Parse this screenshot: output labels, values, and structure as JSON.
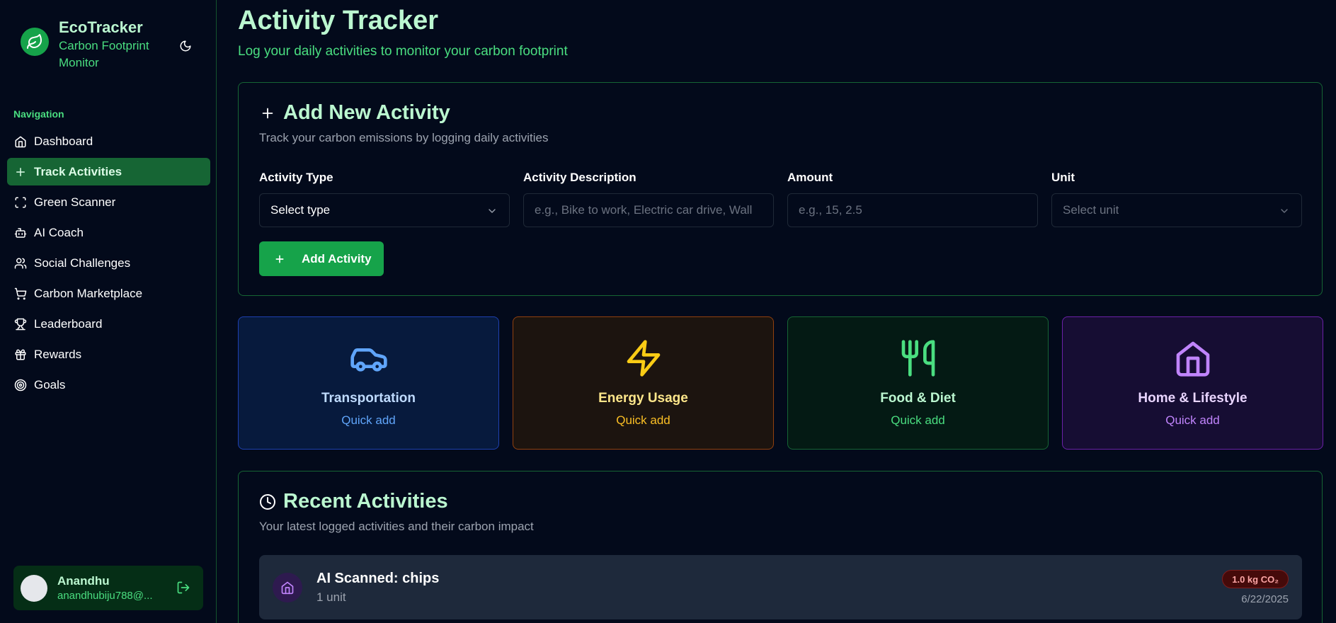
{
  "brand": {
    "title": "EcoTracker",
    "subtitle": "Carbon Footprint Monitor",
    "logo_icon": "leaf-icon",
    "theme_icon": "moon-icon"
  },
  "nav": {
    "heading": "Navigation",
    "items": [
      {
        "label": "Dashboard",
        "icon": "home-icon",
        "active": false
      },
      {
        "label": "Track Activities",
        "icon": "plus-icon",
        "active": true
      },
      {
        "label": "Green Scanner",
        "icon": "scan-icon",
        "active": false
      },
      {
        "label": "AI Coach",
        "icon": "bot-icon",
        "active": false
      },
      {
        "label": "Social Challenges",
        "icon": "users-icon",
        "active": false
      },
      {
        "label": "Carbon Marketplace",
        "icon": "cart-icon",
        "active": false
      },
      {
        "label": "Leaderboard",
        "icon": "trophy-icon",
        "active": false
      },
      {
        "label": "Rewards",
        "icon": "gift-icon",
        "active": false
      },
      {
        "label": "Goals",
        "icon": "target-icon",
        "active": false
      }
    ]
  },
  "user": {
    "name": "Anandhu",
    "email": "anandhubiju788@..."
  },
  "page": {
    "title": "Activity Tracker",
    "subtitle": "Log your daily activities to monitor your carbon footprint"
  },
  "add_activity": {
    "title": "Add New Activity",
    "description": "Track your carbon emissions by logging daily activities",
    "fields": {
      "type": {
        "label": "Activity Type",
        "value": "Select type"
      },
      "description": {
        "label": "Activity Description",
        "placeholder": "e.g., Bike to work, Electric car drive, Wall"
      },
      "amount": {
        "label": "Amount",
        "placeholder": "e.g., 15, 2.5"
      },
      "unit": {
        "label": "Unit",
        "placeholder": "Select unit"
      }
    },
    "button": "Add Activity"
  },
  "quick_add": [
    {
      "title": "Transportation",
      "sub": "Quick add",
      "icon": "car-icon",
      "color": "#60a5fa",
      "title_color": "#bfdbfe"
    },
    {
      "title": "Energy Usage",
      "sub": "Quick add",
      "icon": "zap-icon",
      "color": "#facc15",
      "title_color": "#fde68a"
    },
    {
      "title": "Food & Diet",
      "sub": "Quick add",
      "icon": "utensils-icon",
      "color": "#4ade80",
      "title_color": "#bbf7d0"
    },
    {
      "title": "Home & Lifestyle",
      "sub": "Quick add",
      "icon": "home-icon",
      "color": "#c084fc",
      "title_color": "#e9d5ff"
    }
  ],
  "recent": {
    "title": "Recent Activities",
    "description": "Your latest logged activities and their carbon impact",
    "items": [
      {
        "title": "AI Scanned: chips",
        "amount": "1 unit",
        "co2": "1.0 kg CO₂",
        "date": "6/22/2025",
        "icon": "home-icon"
      }
    ]
  }
}
